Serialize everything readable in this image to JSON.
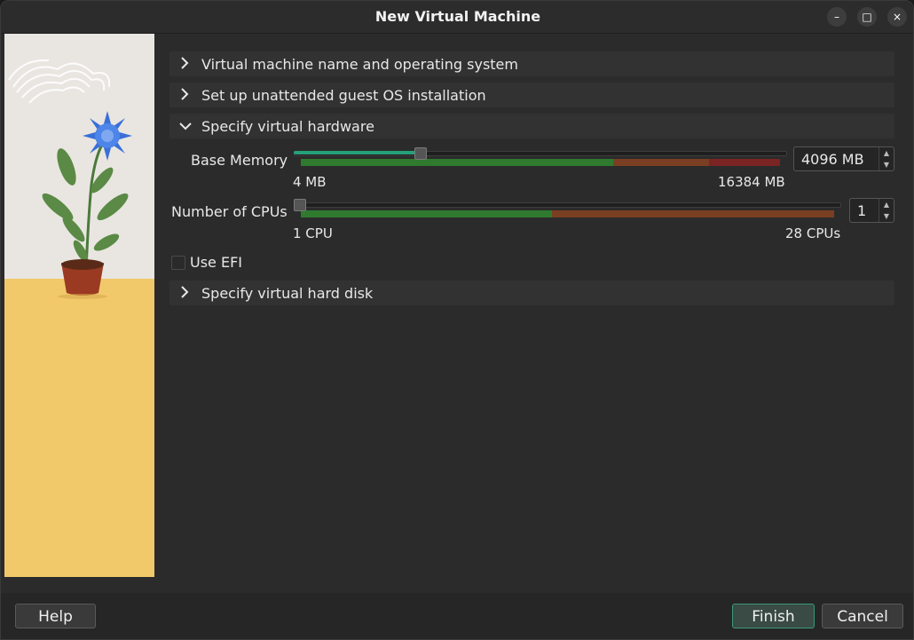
{
  "window": {
    "title": "New Virtual Machine",
    "controls": {
      "minimize": "–",
      "maximize": "□",
      "close": "×"
    }
  },
  "sections": {
    "name_os": {
      "label": "Virtual machine name and operating system",
      "expanded": false
    },
    "unattended": {
      "label": "Set up unattended guest OS installation",
      "expanded": false
    },
    "hardware": {
      "label": "Specify virtual hardware",
      "expanded": true
    },
    "hard_disk": {
      "label": "Specify virtual hard disk",
      "expanded": false
    }
  },
  "hardware": {
    "memory": {
      "label": "Base Memory",
      "value": "4096 MB",
      "min_label": "4 MB",
      "max_label": "16384 MB",
      "level_fraction": 0.25
    },
    "cpus": {
      "label": "Number of CPUs",
      "value": "1",
      "min_label": "1 CPU",
      "max_label": "28 CPUs",
      "level_fraction": 0.0
    },
    "efi": {
      "label": "Use EFI",
      "checked": false
    }
  },
  "buttons": {
    "help": "Help",
    "finish": "Finish",
    "cancel": "Cancel"
  },
  "colors": {
    "accent": "#26a07a",
    "safe": "#2f8a2f",
    "warn": "#8a4a2a",
    "danger": "#8a2a2a"
  }
}
